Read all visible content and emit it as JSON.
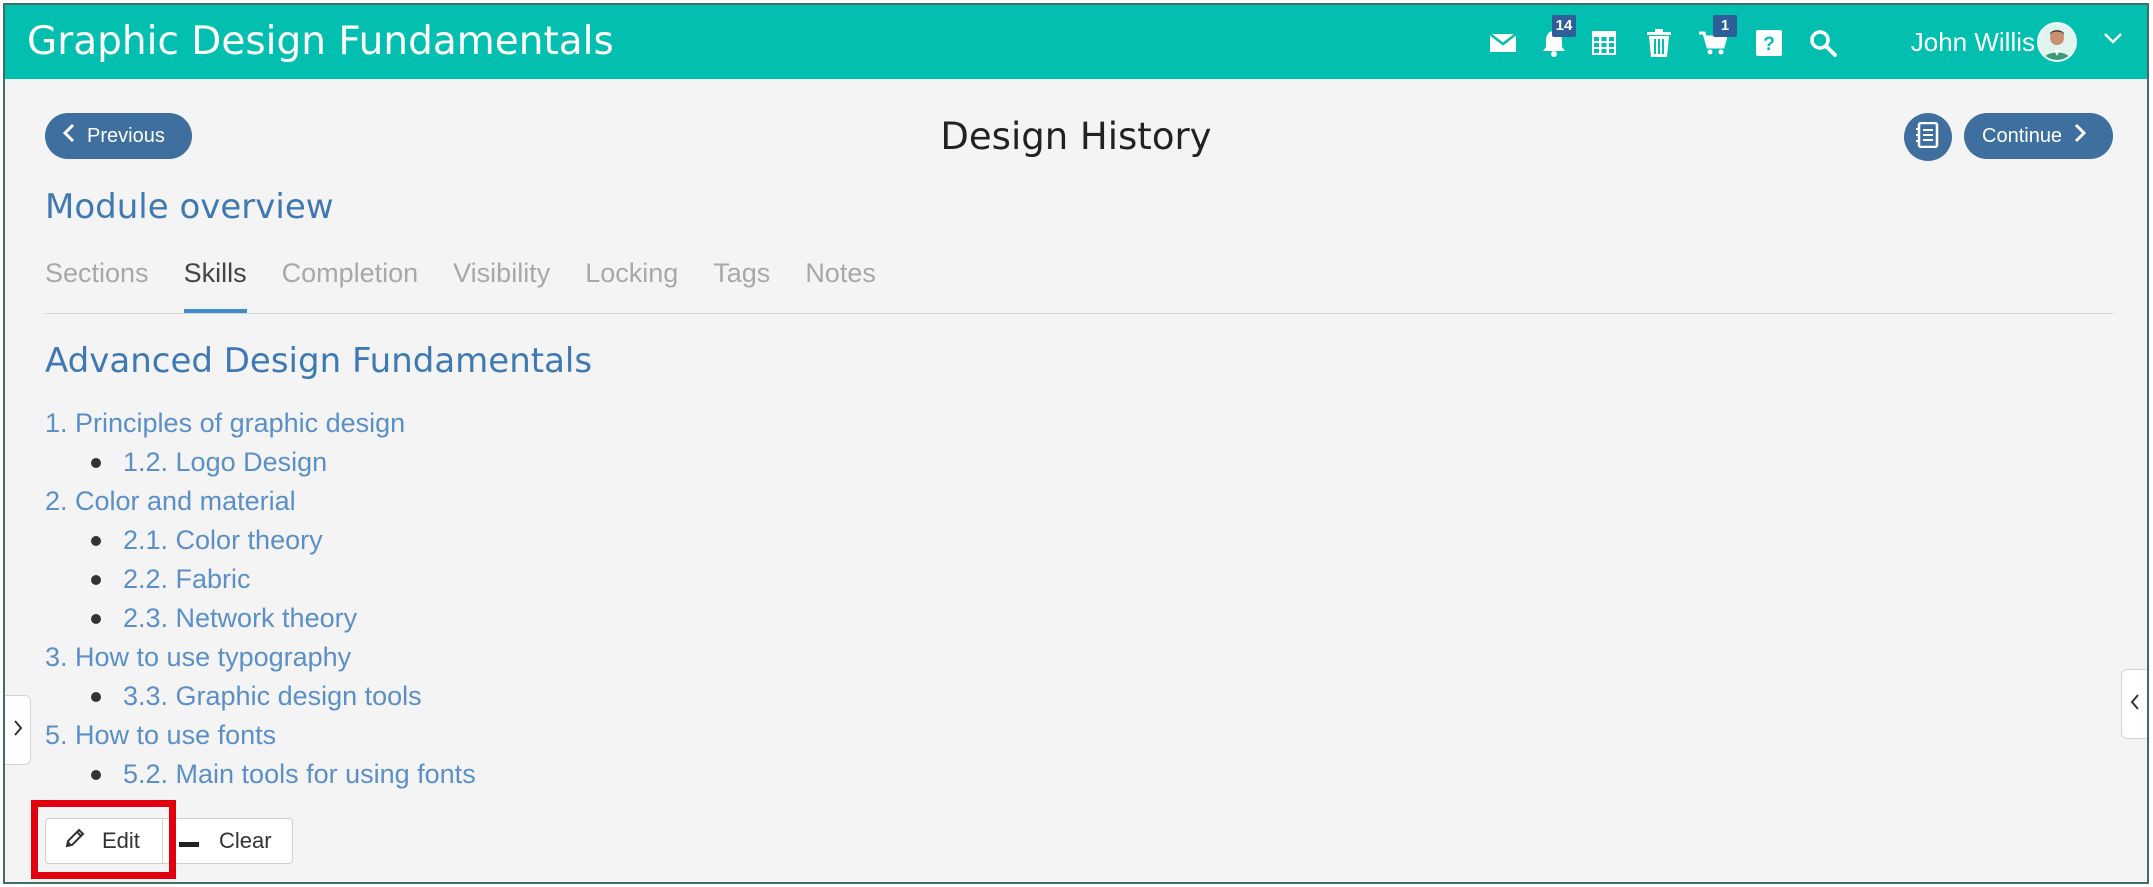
{
  "app": {
    "title": "Graphic Design Fundamentals"
  },
  "topbar": {
    "icons": [
      "envelope-icon",
      "bell-icon",
      "calendar-grid-icon",
      "trash-icon",
      "cart-icon",
      "help-icon",
      "search-icon"
    ],
    "notifications_badge": "14",
    "cart_badge": "1",
    "user_name": "John Willis",
    "accent_color": "#03bfb0"
  },
  "header": {
    "previous_label": "Previous",
    "continue_label": "Continue",
    "page_title": "Design History",
    "module_overview": "Module overview",
    "button_color": "#3e6f9e"
  },
  "tabs": [
    {
      "label": "Sections",
      "active": false
    },
    {
      "label": "Skills",
      "active": true
    },
    {
      "label": "Completion",
      "active": false
    },
    {
      "label": "Visibility",
      "active": false
    },
    {
      "label": "Locking",
      "active": false
    },
    {
      "label": "Tags",
      "active": false
    },
    {
      "label": "Notes",
      "active": false
    }
  ],
  "content": {
    "heading": "Advanced Design Fundamentals",
    "items": [
      {
        "level": 1,
        "text": "1. Principles of graphic design"
      },
      {
        "level": 2,
        "text": "1.2. Logo Design"
      },
      {
        "level": 1,
        "text": "2. Color and material"
      },
      {
        "level": 2,
        "text": "2.1. Color theory"
      },
      {
        "level": 2,
        "text": "2.2. Fabric"
      },
      {
        "level": 2,
        "text": "2.3. Network theory"
      },
      {
        "level": 1,
        "text": "3. How to use typography"
      },
      {
        "level": 2,
        "text": "3.3. Graphic design tools"
      },
      {
        "level": 1,
        "text": "5. How to use fonts"
      },
      {
        "level": 2,
        "text": "5.2. Main tools for using fonts"
      }
    ]
  },
  "actions": {
    "edit_label": "Edit",
    "clear_label": "Clear",
    "highlight_color": "#e3000e"
  }
}
